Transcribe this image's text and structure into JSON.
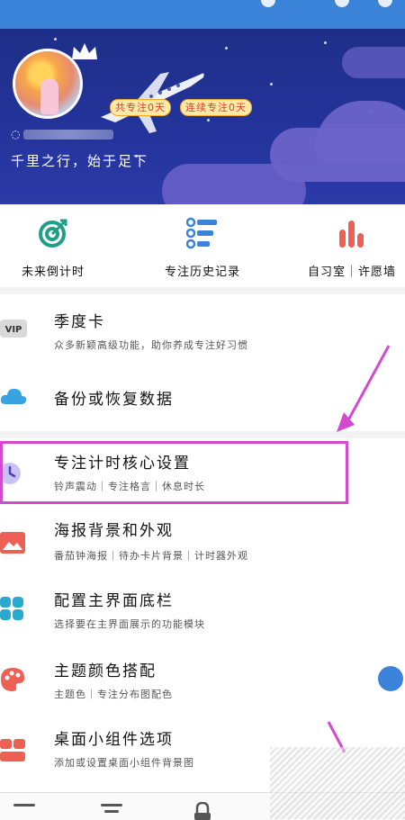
{
  "profile": {
    "badges": [
      "共专注0天",
      "连续专注0天"
    ],
    "motto": "千里之行，始于足下"
  },
  "quick_actions": [
    {
      "label": "未来倒计时",
      "icon": "target-arrow-icon",
      "color": "#1f9e88"
    },
    {
      "label": "专注历史记录",
      "icon": "list-icon",
      "color": "#3b82d9"
    },
    {
      "label": "自习室｜许愿墙",
      "icon": "bar-chart-icon",
      "color": "#ee5f55"
    }
  ],
  "settings": [
    {
      "title": "季度卡",
      "subtitle": "众多新颖高级功能，助你养成专注好习惯",
      "icon": "vip-icon",
      "badge": "VIP"
    },
    {
      "title": "备份或恢复数据",
      "subtitle": "",
      "icon": "cloud-icon"
    },
    {
      "title": "专注计时核心设置",
      "subtitle": "铃声震动｜专注格言｜休息时长",
      "icon": "clock-icon"
    },
    {
      "title": "海报背景和外观",
      "subtitle": "番茄钟海报｜待办卡片背景｜计时器外观",
      "icon": "image-icon"
    },
    {
      "title": "配置主界面底栏",
      "subtitle": "选择要在主界面展示的功能模块",
      "icon": "grid-icon"
    },
    {
      "title": "主题颜色搭配",
      "subtitle": "主题色｜专注分布图配色",
      "icon": "palette-icon"
    },
    {
      "title": "桌面小组件选项",
      "subtitle": "添加或设置桌面小组件背景图",
      "icon": "widget-icon"
    }
  ],
  "colors": {
    "accent": "#3b82d9",
    "hero": "#23339a",
    "highlight": "#d34ad1"
  }
}
